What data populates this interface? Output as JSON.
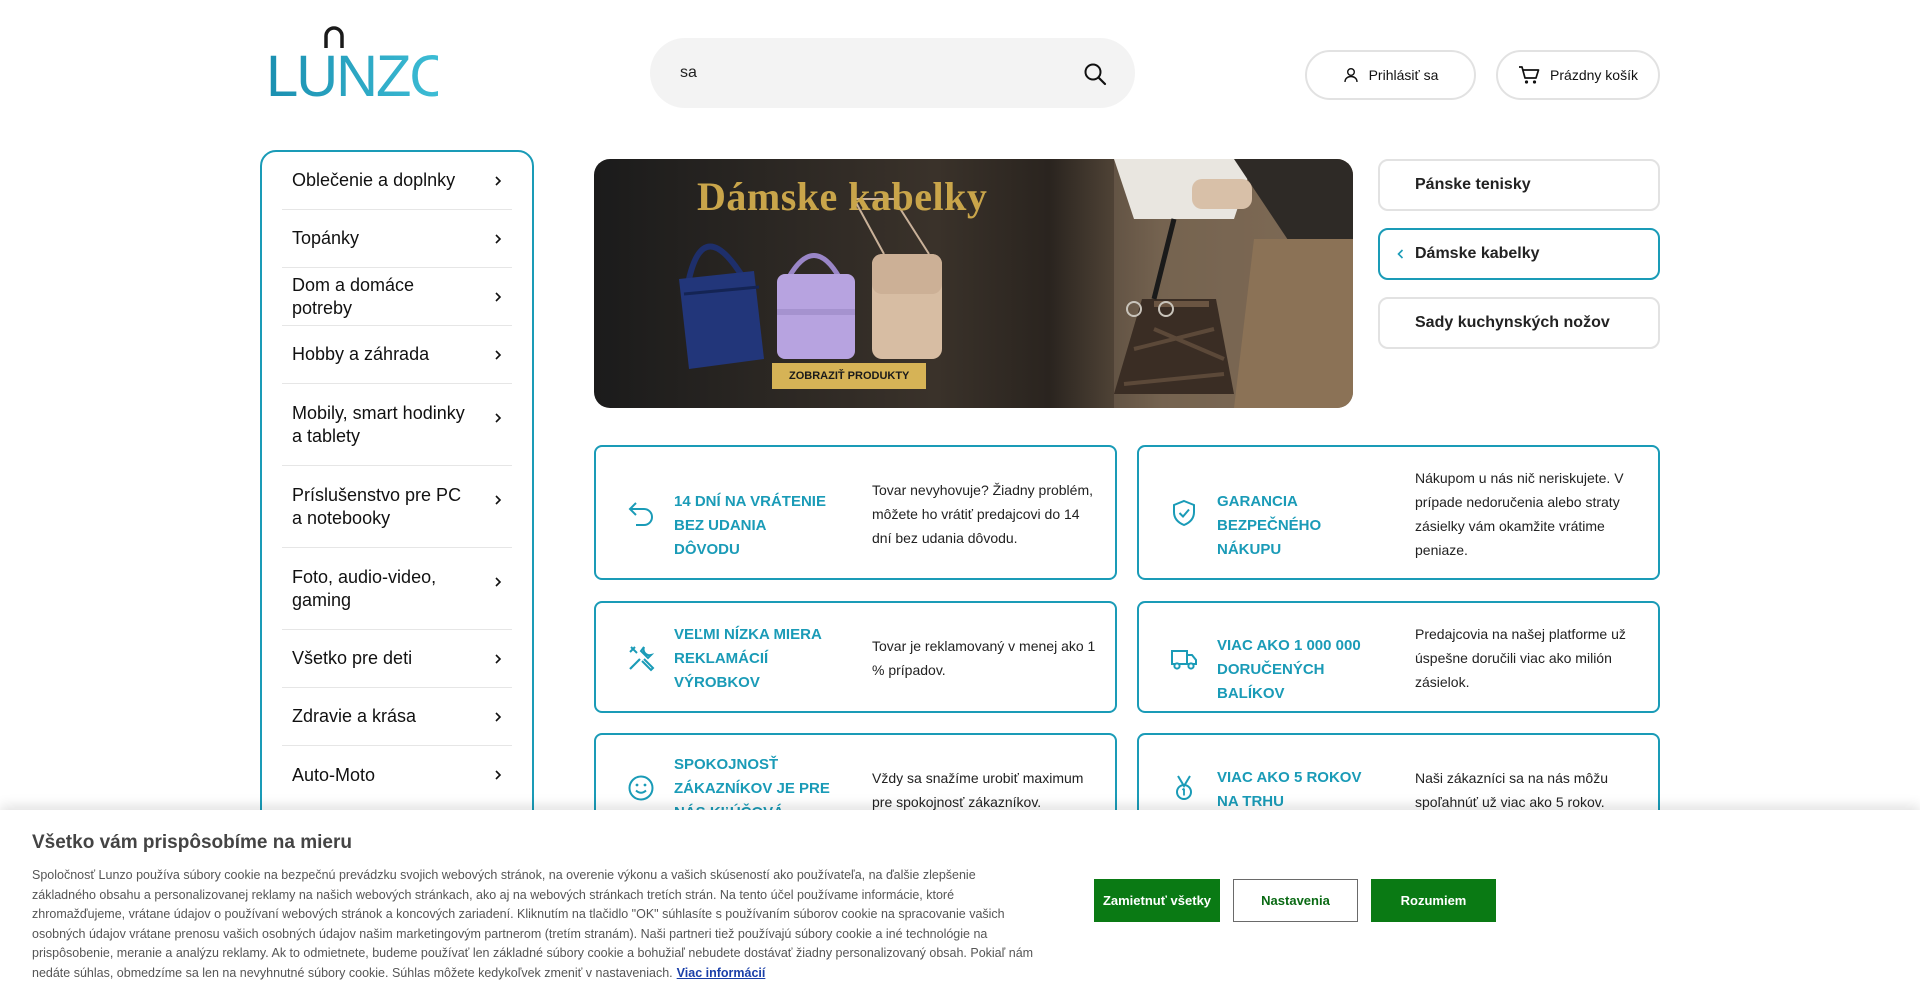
{
  "header": {
    "logo_text": "LUNZO",
    "search": {
      "value": "sa"
    },
    "login_label": "Prihlásiť sa",
    "cart_label": "Prázdny košík"
  },
  "sidebar": {
    "items": [
      {
        "label": "Oblečenie a doplnky"
      },
      {
        "label": "Topánky"
      },
      {
        "label": "Dom a domáce potreby"
      },
      {
        "label": "Hobby a záhrada"
      },
      {
        "label": "Mobily, smart hodinky a tablety"
      },
      {
        "label": "Príslušenstvo pre PC a notebooky"
      },
      {
        "label": "Foto, audio-video, gaming"
      },
      {
        "label": "Všetko pre deti"
      },
      {
        "label": "Zdravie a krása"
      },
      {
        "label": "Auto-Moto"
      }
    ]
  },
  "banner": {
    "title": "Dámske kabelky",
    "cta": "ZOBRAZIŤ PRODUKTY"
  },
  "quick_links": [
    {
      "label": "Pánske tenisky"
    },
    {
      "label": "Dámske kabelky"
    },
    {
      "label": "Sady kuchynských nožov"
    }
  ],
  "benefits": [
    {
      "title": "14 DNÍ NA VRÁTENIE BEZ UDANIA DÔVODU",
      "text": "Tovar nevyhovuje? Žiadny problém, môžete ho vrátiť predajcovi do 14 dní bez udania dôvodu.",
      "icon": "return-arrow-icon"
    },
    {
      "title": "GARANCIA BEZPEČNÉHO NÁKUPU",
      "text": "Nákupom u nás nič neriskujete. V prípade nedoručenia alebo straty zásielky vám okamžite vrátime peniaze.",
      "icon": "shield-check-icon"
    },
    {
      "title": "VEĽMI NÍZKA MIERA REKLAMÁCIÍ VÝROBKOV",
      "text": "Tovar je reklamovaný v menej ako 1 % prípadov.",
      "icon": "tools-icon"
    },
    {
      "title": "VIAC AKO 1 000 000 DORUČENÝCH BALÍKOV",
      "text": "Predajcovia na našej platforme už úspešne doručili viac ako milión zásielok.",
      "icon": "truck-icon"
    },
    {
      "title": "SPOKOJNOSŤ ZÁKAZNÍKOV JE PRE NÁS KĽÚČOVÁ",
      "text": "Vždy sa snažíme urobiť maximum pre spokojnosť zákazníkov.",
      "icon": "smile-icon"
    },
    {
      "title": "VIAC AKO 5 ROKOV NA TRHU",
      "text": "Naši zákazníci sa na nás môžu spoľahnúť už viac ako 5 rokov.",
      "icon": "medal-icon"
    }
  ],
  "cookie": {
    "title": "Všetko vám prispôsobíme na mieru",
    "text": "Spoločnosť Lunzo používa súbory cookie na bezpečnú prevádzku svojich webových stránok, na overenie výkonu a vašich skúseností ako používateľa, na ďalšie zlepšenie základného obsahu a personalizovanej reklamy na našich webových stránkach, ako aj na webových stránkach tretích strán. Na tento účel používame informácie, ktoré zhromažďujeme, vrátane údajov o používaní webových stránok a koncových zariadení. Kliknutím na tlačidlo \"OK\" súhlasíte s používaním súborov cookie na spracovanie vašich osobných údajov vrátane prenosu vašich osobných údajov našim marketingovým partnerom (tretím stranám). Naši partneri tiež používajú súbory cookie a iné technológie na prispôsobenie, meranie a analýzu reklamy. Ak to odmietnete, budeme používať len základné súbory cookie a bohužiaľ nebudete dostávať žiadny personalizovaný obsah. Pokiaľ nám nedáte súhlas, obmedzíme sa len na nevyhnutné súbory cookie. Súhlas môžete kedykoľvek zmeniť v nastaveniach.",
    "more_link": "Viac informácií",
    "reject_label": "Zamietnuť všetky",
    "settings_label": "Nastavenia",
    "accept_label": "Rozumiem"
  },
  "colors": {
    "accent": "#1a9bb7",
    "cookie_button": "#0a7a14",
    "banner_gold": "#c9a54a"
  }
}
